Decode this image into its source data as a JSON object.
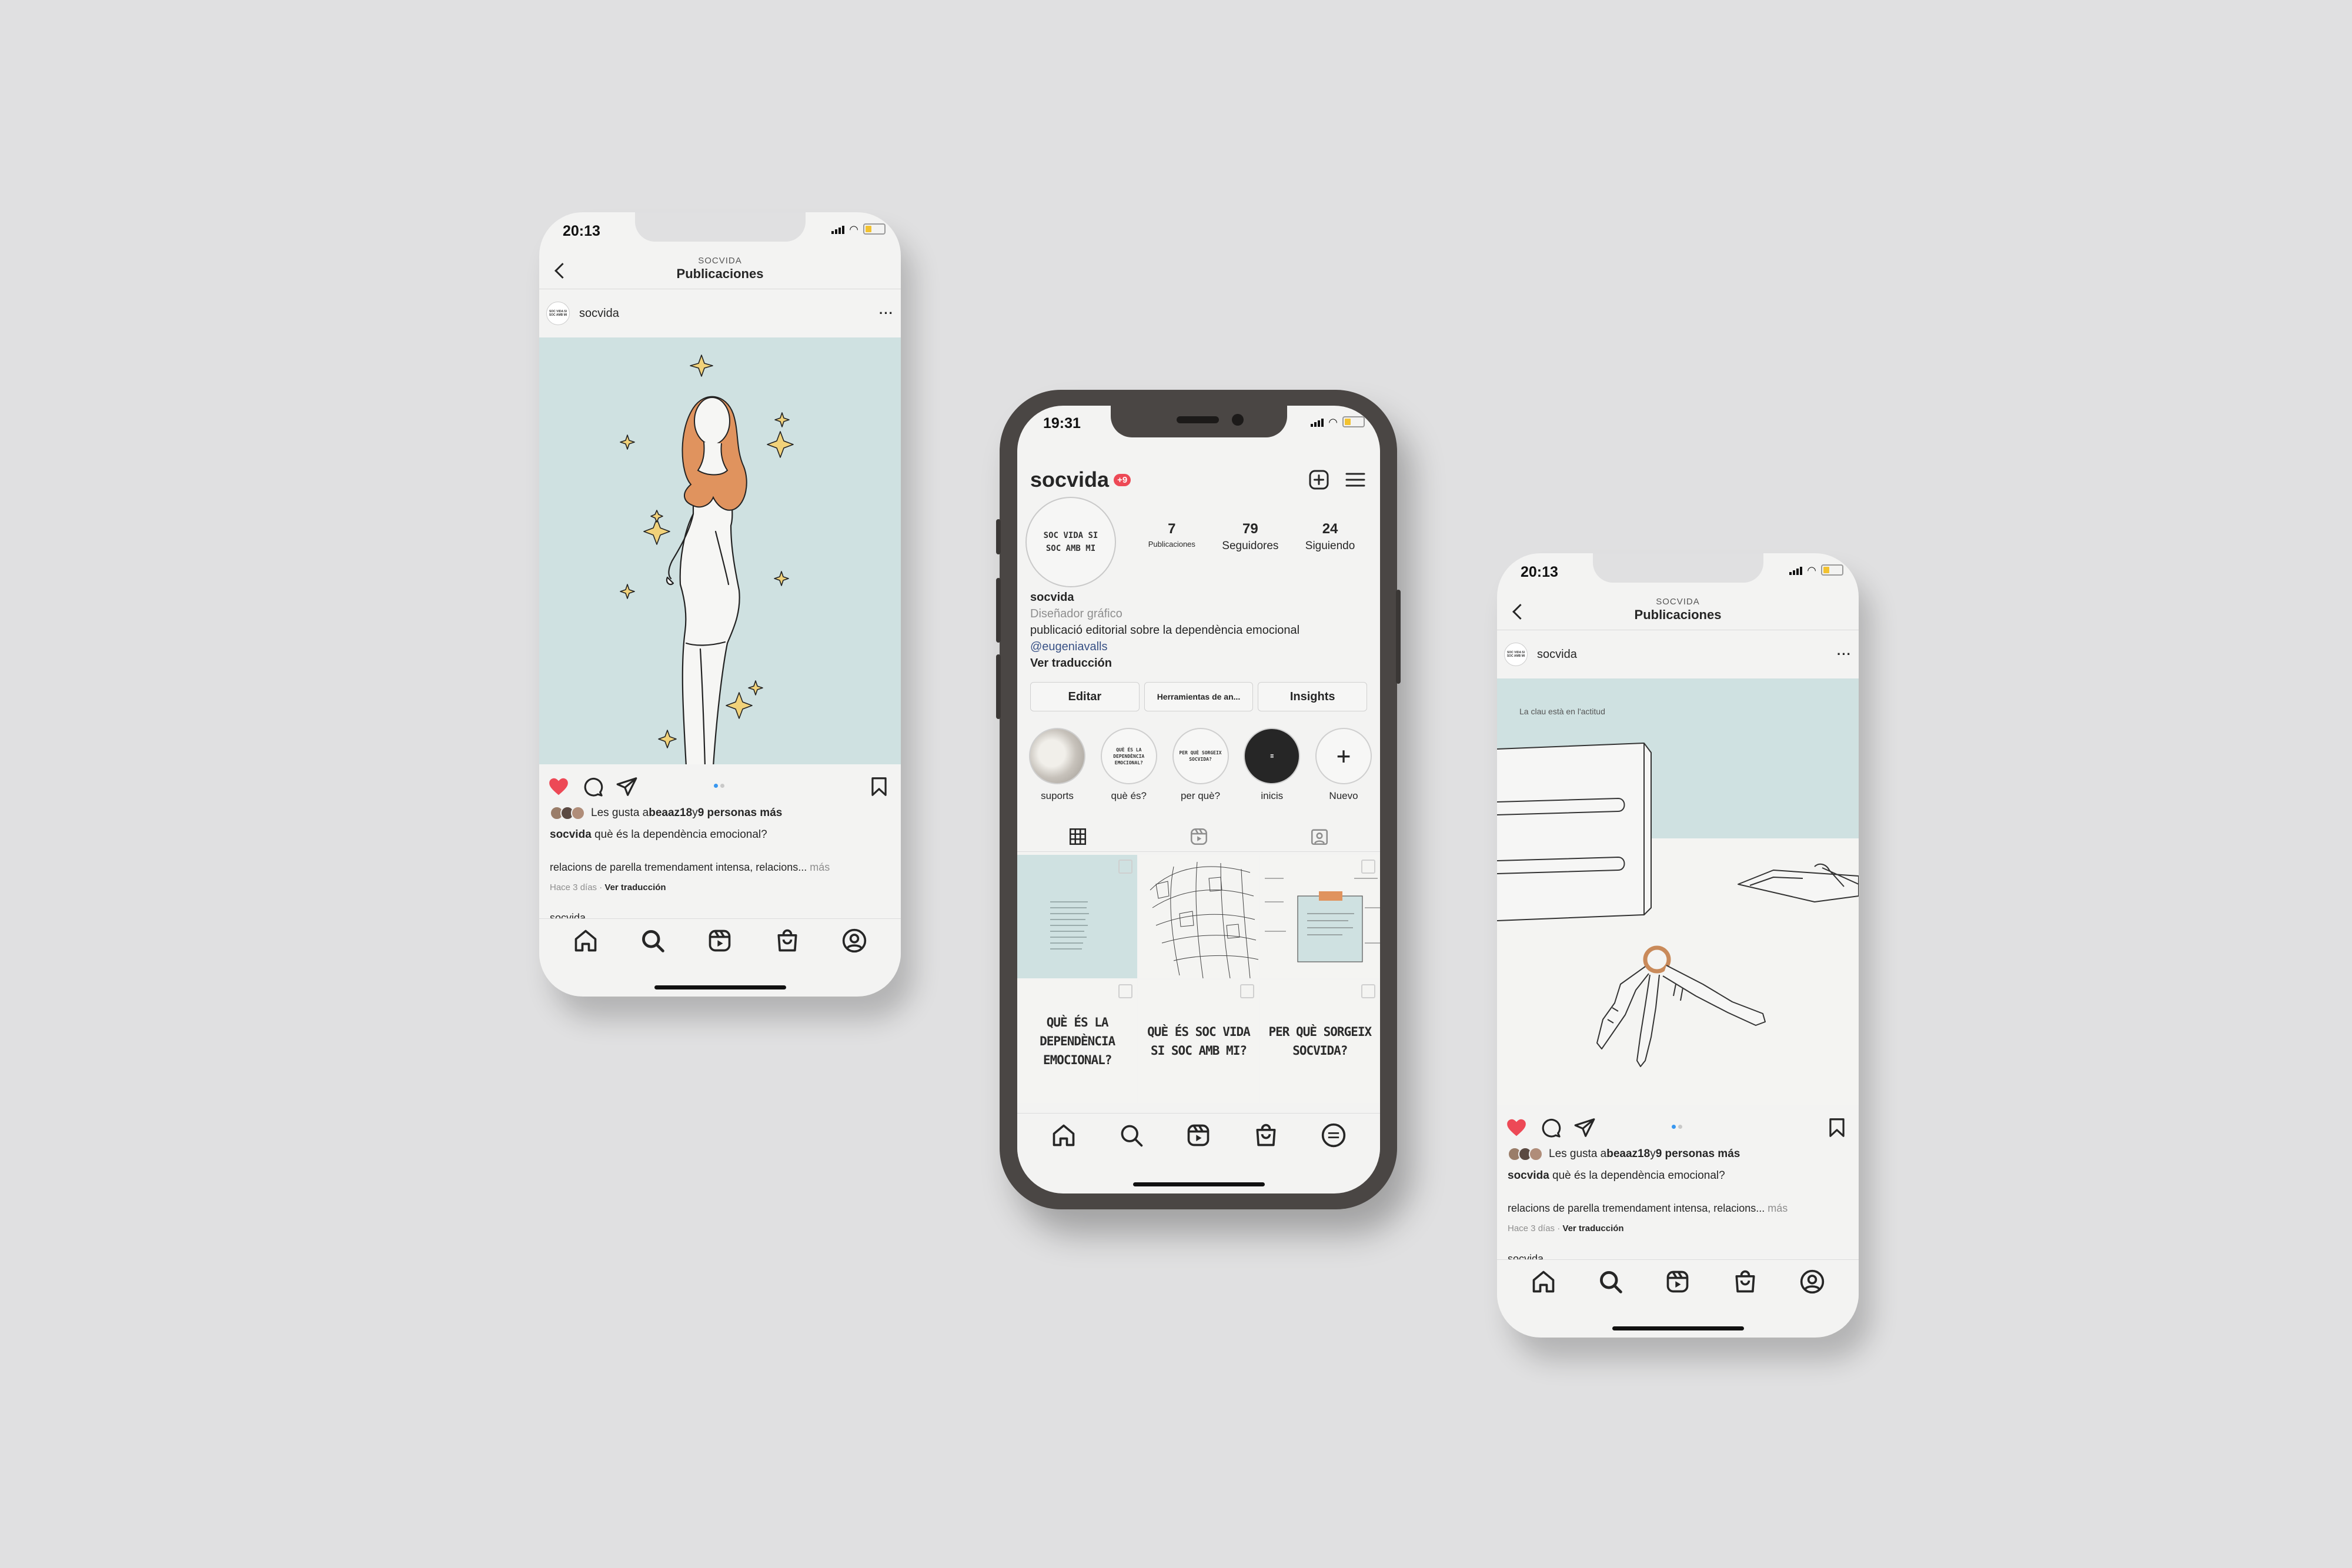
{
  "left_phone": {
    "time": "20:13",
    "header_sub": "SOCVIDA",
    "header_title": "Publicaciones",
    "username": "socvida",
    "avatar_text": "SOC VIDA SI SOC AMB MI",
    "likes_prefix": "Les gusta a ",
    "likes_user": "beaaz18",
    "likes_mid": " y ",
    "likes_count": "9 personas más",
    "caption_user": "socvida",
    "caption_text": " què és la dependència emocional?",
    "description": "relacions de parella tremendament intensa, relacions...",
    "more": " más",
    "time_ago": "Hace 3 días",
    "separator": " · ",
    "see_translation": "Ver traducción",
    "next_user": "socvida"
  },
  "center_phone": {
    "time": "19:31",
    "profile_name": "socvida",
    "notif_count": "+9",
    "avatar_text_1": "SOC VIDA SI",
    "avatar_text_2": "SOC AMB MI",
    "stats": [
      {
        "num": "7",
        "label": "Publicaciones"
      },
      {
        "num": "79",
        "label": "Seguidores"
      },
      {
        "num": "24",
        "label": "Siguiendo"
      }
    ],
    "bio_name": "socvida",
    "bio_category": "Diseñador gráfico",
    "bio_text": "publicació editorial sobre la dependència emocional",
    "bio_link": "@eugeniavalls",
    "bio_translate": "Ver traducción",
    "buttons": {
      "edit": "Editar",
      "tools": "Herramientas de an...",
      "insights": "Insights"
    },
    "highlights": [
      {
        "label": "suports",
        "text": ""
      },
      {
        "label": "què és?",
        "text": "QUÈ ÉS LA DEPENDÈNCIA EMOCIONAL?"
      },
      {
        "label": "per què?",
        "text": "PER QUÈ SORGEIX SOCVIDA?"
      },
      {
        "label": "inicis",
        "text": "≡"
      },
      {
        "label": "Nuevo",
        "text": "+"
      }
    ],
    "grid_text": [
      "QUÈ ÉS LA DEPENDÈNCIA EMOCIONAL?",
      "QUÈ ÉS SOC VIDA SI SOC AMB MI?",
      "PER QUÈ SORGEIX SOCVIDA?"
    ]
  },
  "right_phone": {
    "time": "20:13",
    "header_sub": "SOCVIDA",
    "header_title": "Publicaciones",
    "username": "socvida",
    "avatar_text": "SOC VIDA SI SOC AMB MI",
    "image_caption": "La clau està en l'actitud",
    "likes_prefix": "Les gusta a ",
    "likes_user": "beaaz18",
    "likes_mid": " y ",
    "likes_count": "9 personas más",
    "caption_user": "socvida",
    "caption_text": " què és la dependència emocional?",
    "description": "relacions de parella tremendament intensa, relacions...",
    "more": " más",
    "time_ago": "Hace 3 días",
    "separator": " · ",
    "see_translation": "Ver traducción",
    "next_user": "socvida"
  },
  "colors": {
    "background": "#e0e0e1",
    "screen": "#f3f3f2",
    "post_bg": "#cfe1e1",
    "like_red": "#ed4956",
    "dot_blue": "#3897f0",
    "hair_orange": "#e0935e",
    "star_yellow": "#f1d27a",
    "device_frame": "#4a4644"
  }
}
